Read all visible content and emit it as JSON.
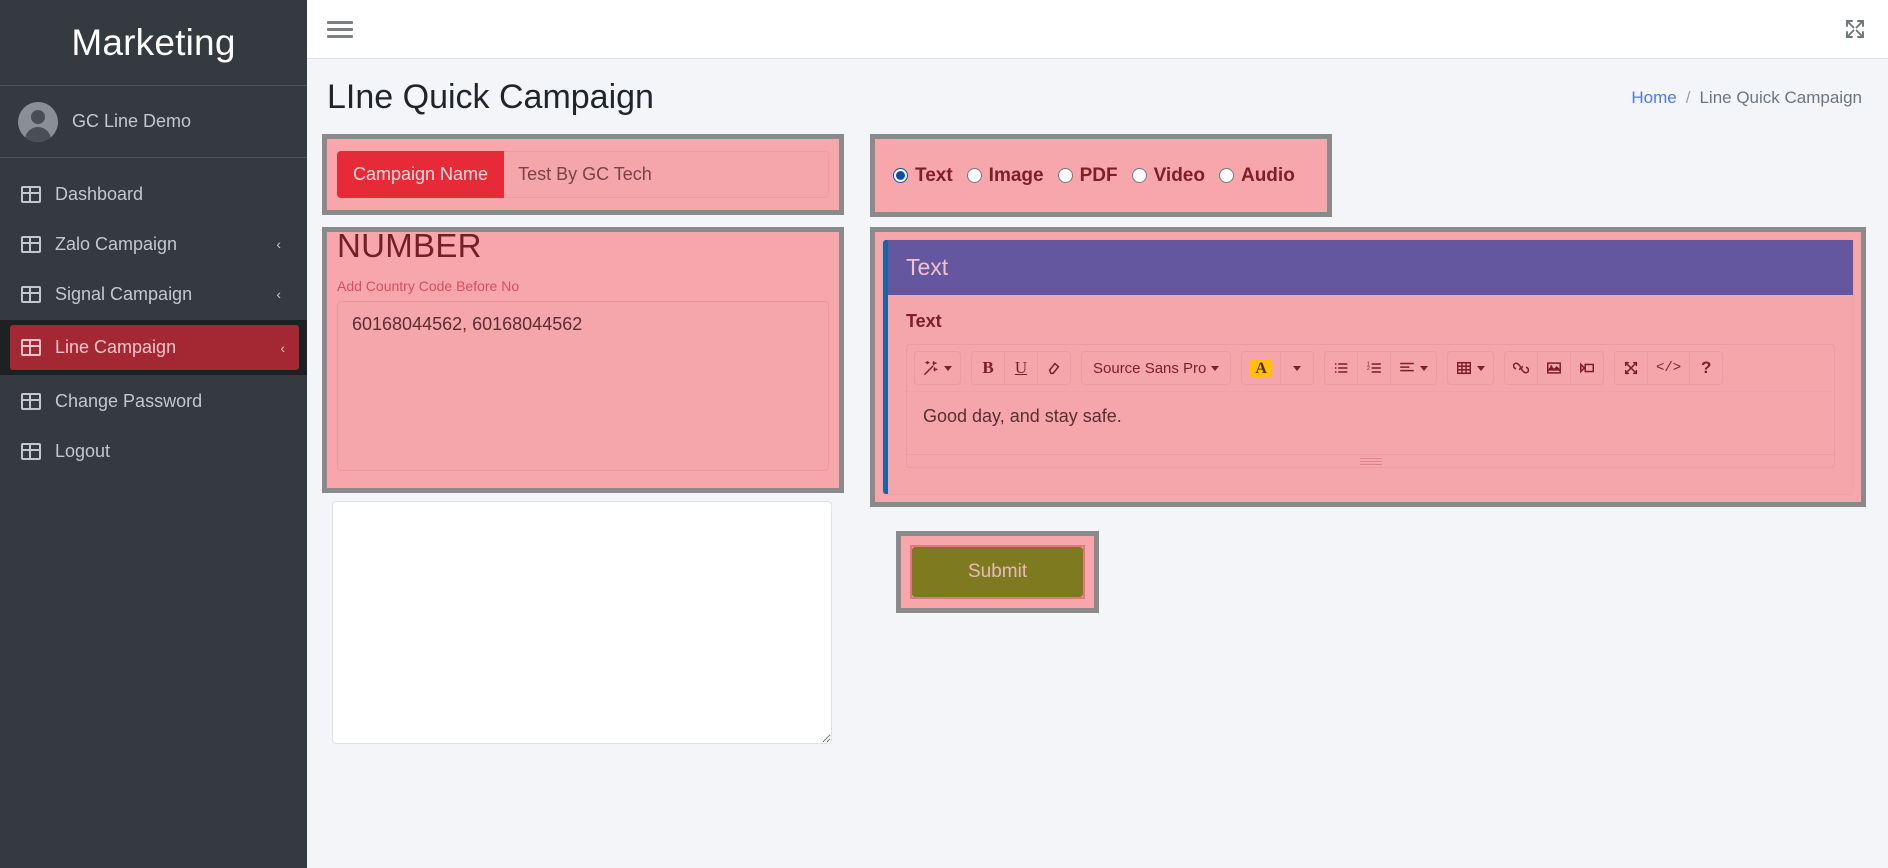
{
  "sidebar": {
    "brand": "Marketing",
    "user": {
      "name": "GC Line Demo",
      "avatar_icon": "user-avatar-icon"
    },
    "items": [
      {
        "label": "Dashboard",
        "icon": "grid-icon",
        "has_chevron": false,
        "active": false
      },
      {
        "label": "Zalo Campaign",
        "icon": "grid-icon",
        "has_chevron": true,
        "active": false
      },
      {
        "label": "Signal Campaign",
        "icon": "grid-icon",
        "has_chevron": true,
        "active": false
      },
      {
        "label": "Line Campaign",
        "icon": "grid-icon",
        "has_chevron": true,
        "active": true
      },
      {
        "label": "Change Password",
        "icon": "grid-icon",
        "has_chevron": false,
        "active": false
      },
      {
        "label": "Logout",
        "icon": "grid-icon",
        "has_chevron": false,
        "active": false
      }
    ],
    "chevron_glyph": "‹"
  },
  "topbar": {
    "menu_toggle_icon": "hamburger-icon",
    "expand_icon": "expand-arrows-icon"
  },
  "header": {
    "title": "LIne Quick Campaign",
    "breadcrumb": {
      "home": "Home",
      "separator": "/",
      "current": "Line Quick Campaign"
    }
  },
  "form": {
    "campaign_name": {
      "label": "Campaign Name",
      "value": "Test By GC Tech",
      "placeholder": "Test By GC Tech"
    },
    "media_type": {
      "selected": "Text",
      "options": [
        "Text",
        "Image",
        "PDF",
        "Video",
        "Audio"
      ]
    },
    "number": {
      "heading": "NUMBER",
      "hint": "Add Country Code Before No",
      "value": "60168044562, 60168044562",
      "placeholder": ""
    },
    "secondary_textarea": {
      "value": "",
      "placeholder": ""
    },
    "submit": {
      "label": "Submit"
    }
  },
  "text_card": {
    "header_title": "Text",
    "field_label": "Text",
    "editor": {
      "content": "Good day, and stay safe.",
      "font_name": "Source Sans Pro",
      "toolbar": [
        {
          "name": "style-magic-icon",
          "glyph": "✨",
          "caret": true
        },
        {
          "name": "bold-icon",
          "glyph": "B",
          "caret": false
        },
        {
          "name": "underline-icon",
          "glyph": "U",
          "caret": false
        },
        {
          "name": "remove-format-eraser-icon",
          "glyph": "▤",
          "caret": false
        },
        {
          "name": "font-name-dropdown",
          "glyph": "Source Sans Pro",
          "caret": true
        },
        {
          "name": "font-color-icon",
          "glyph": "A",
          "caret": false
        },
        {
          "name": "font-color-dropdown",
          "glyph": "",
          "caret": true
        },
        {
          "name": "unordered-list-icon",
          "glyph": "≡",
          "caret": false
        },
        {
          "name": "ordered-list-icon",
          "glyph": "≣",
          "caret": false
        },
        {
          "name": "paragraph-align-icon",
          "glyph": "≡",
          "caret": true
        },
        {
          "name": "table-icon",
          "glyph": "⊞",
          "caret": true
        },
        {
          "name": "link-icon",
          "glyph": "☍",
          "caret": false
        },
        {
          "name": "picture-icon",
          "glyph": "❑",
          "caret": false
        },
        {
          "name": "video-icon",
          "glyph": "▶",
          "caret": false
        },
        {
          "name": "fullscreen-icon",
          "glyph": "⤢",
          "caret": false
        },
        {
          "name": "code-view-icon",
          "glyph": "</>",
          "caret": false
        },
        {
          "name": "help-icon",
          "glyph": "?",
          "caret": false
        }
      ]
    }
  },
  "colors": {
    "sidebar_bg": "#343a40",
    "active_nav": "#a32834",
    "highlight_border": "#8a8a8a",
    "highlight_fill": "#f7a7ab",
    "label_red": "#e62a38",
    "card_header_purple": "#64579f",
    "card_accent_blue": "#1565a7",
    "submit_olive": "#7d7a1f",
    "breadcrumb_link": "#4b7bec"
  }
}
